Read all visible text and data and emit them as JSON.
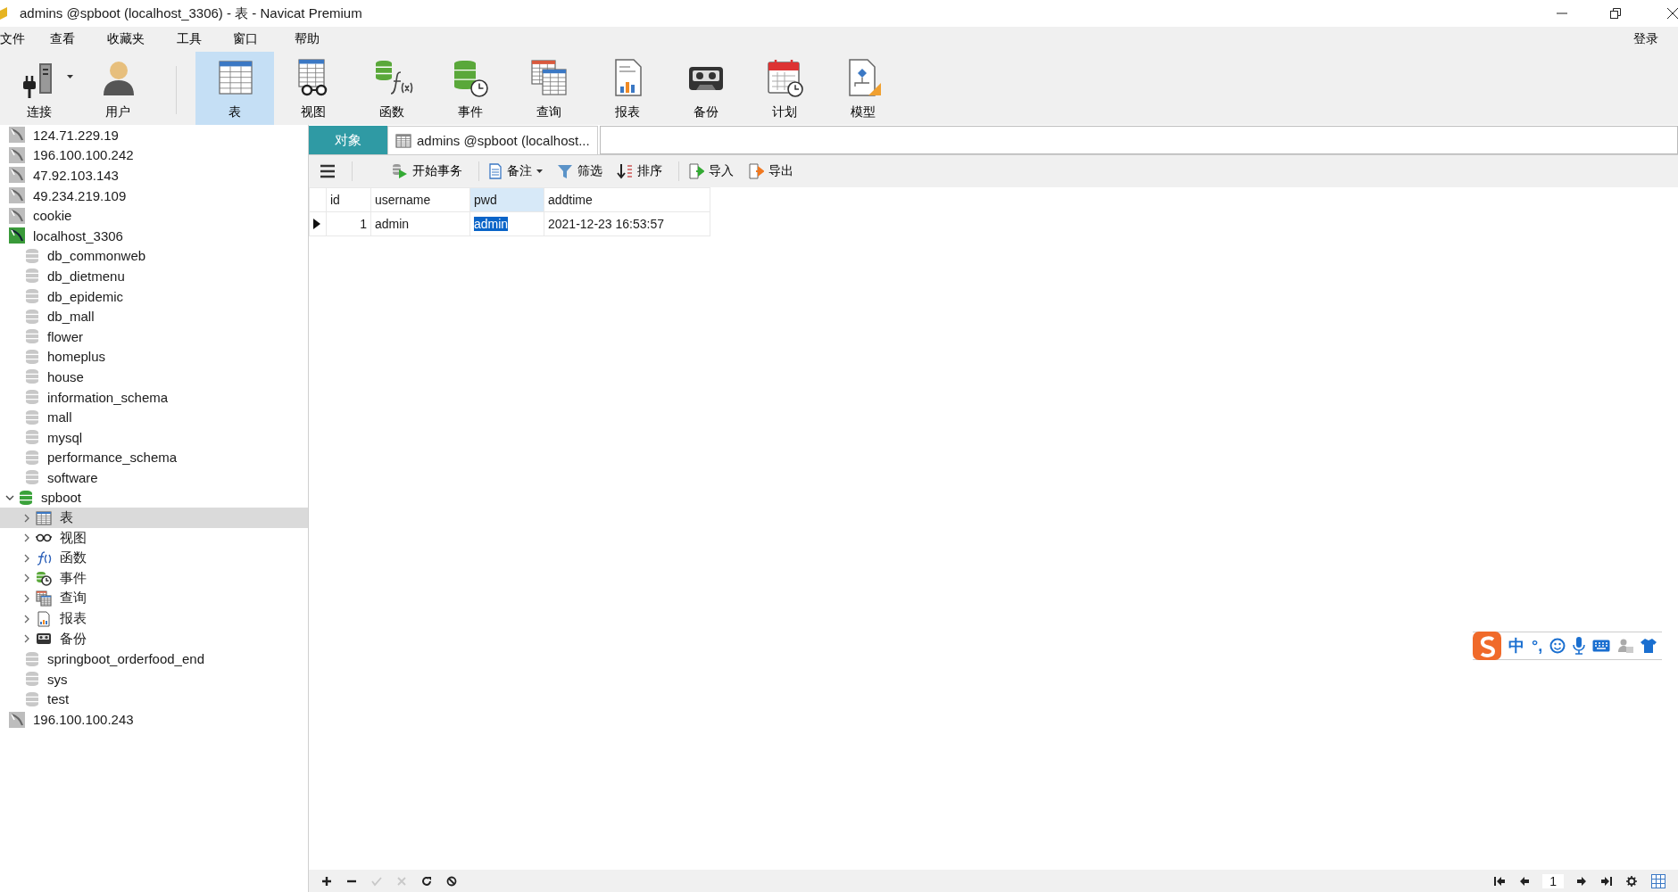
{
  "window": {
    "title": "admins @spboot (localhost_3306) - 表 - Navicat Premium"
  },
  "menu": [
    {
      "label": "文件"
    },
    {
      "label": "查看"
    },
    {
      "label": "收藏夹"
    },
    {
      "label": "工具"
    },
    {
      "label": "窗口"
    },
    {
      "label": "帮助"
    }
  ],
  "login": "登录",
  "toolbar": [
    {
      "label": "连接",
      "kind": "connect",
      "selected": false,
      "dropdown": true
    },
    {
      "label": "用户",
      "kind": "user",
      "selected": false,
      "dropdown": false
    },
    {
      "label": "表",
      "kind": "table",
      "selected": true,
      "dropdown": false
    },
    {
      "label": "视图",
      "kind": "view",
      "selected": false,
      "dropdown": false
    },
    {
      "label": "函数",
      "kind": "function",
      "selected": false,
      "dropdown": false
    },
    {
      "label": "事件",
      "kind": "event",
      "selected": false,
      "dropdown": false
    },
    {
      "label": "查询",
      "kind": "query",
      "selected": false,
      "dropdown": false
    },
    {
      "label": "报表",
      "kind": "report",
      "selected": false,
      "dropdown": false
    },
    {
      "label": "备份",
      "kind": "backup",
      "selected": false,
      "dropdown": false
    },
    {
      "label": "计划",
      "kind": "schedule",
      "selected": false,
      "dropdown": false
    },
    {
      "label": "模型",
      "kind": "model",
      "selected": false,
      "dropdown": false
    }
  ],
  "tree": [
    {
      "label": "124.71.229.19",
      "kind": "connection",
      "connected": false,
      "selected": false
    },
    {
      "label": "196.100.100.242",
      "kind": "connection",
      "connected": false,
      "selected": false
    },
    {
      "label": "47.92.103.143",
      "kind": "connection",
      "connected": false,
      "selected": false
    },
    {
      "label": "49.234.219.109",
      "kind": "connection",
      "connected": false,
      "selected": false
    },
    {
      "label": "cookie",
      "kind": "connection",
      "connected": false,
      "selected": false
    },
    {
      "label": "localhost_3306",
      "kind": "connection",
      "connected": true,
      "selected": false,
      "children": [
        {
          "label": "db_commonweb",
          "kind": "database",
          "open": false,
          "selected": false
        },
        {
          "label": "db_dietmenu",
          "kind": "database",
          "open": false,
          "selected": false
        },
        {
          "label": "db_epidemic",
          "kind": "database",
          "open": false,
          "selected": false
        },
        {
          "label": "db_mall",
          "kind": "database",
          "open": false,
          "selected": false
        },
        {
          "label": "flower",
          "kind": "database",
          "open": false,
          "selected": false
        },
        {
          "label": "homeplus",
          "kind": "database",
          "open": false,
          "selected": false
        },
        {
          "label": "house",
          "kind": "database",
          "open": false,
          "selected": false
        },
        {
          "label": "information_schema",
          "kind": "database",
          "open": false,
          "selected": false
        },
        {
          "label": "mall",
          "kind": "database",
          "open": false,
          "selected": false
        },
        {
          "label": "mysql",
          "kind": "database",
          "open": false,
          "selected": false
        },
        {
          "label": "performance_schema",
          "kind": "database",
          "open": false,
          "selected": false
        },
        {
          "label": "software",
          "kind": "database",
          "open": false,
          "selected": false
        },
        {
          "label": "spboot",
          "kind": "database",
          "open": true,
          "selected": false,
          "expanded": true,
          "children": [
            {
              "label": "表",
              "kind": "tables",
              "selected": true,
              "expanded": false
            },
            {
              "label": "视图",
              "kind": "views",
              "selected": false,
              "expanded": false
            },
            {
              "label": "函数",
              "kind": "functions",
              "selected": false,
              "expanded": false
            },
            {
              "label": "事件",
              "kind": "events",
              "selected": false,
              "expanded": false
            },
            {
              "label": "查询",
              "kind": "queries",
              "selected": false,
              "expanded": false
            },
            {
              "label": "报表",
              "kind": "reports",
              "selected": false,
              "expanded": false
            },
            {
              "label": "备份",
              "kind": "backups",
              "selected": false,
              "expanded": false
            }
          ]
        },
        {
          "label": "springboot_orderfood_end",
          "kind": "database",
          "open": false,
          "selected": false
        },
        {
          "label": "sys",
          "kind": "database",
          "open": false,
          "selected": false
        },
        {
          "label": "test",
          "kind": "database",
          "open": false,
          "selected": false
        }
      ]
    },
    {
      "label": "196.100.100.243",
      "kind": "connection",
      "connected": false,
      "selected": false
    }
  ],
  "tabs": [
    {
      "label": "对象",
      "kind": "objects",
      "selected": false
    },
    {
      "label": "admins @spboot (localhost...",
      "kind": "table",
      "selected": true
    }
  ],
  "grid_toolbar": [
    {
      "kind": "menu"
    },
    {
      "label": "开始事务",
      "kind": "transaction"
    },
    {
      "label": "备注",
      "kind": "note",
      "dropdown": true
    },
    {
      "label": "筛选",
      "kind": "filter"
    },
    {
      "label": "排序",
      "kind": "sort"
    },
    {
      "label": "导入",
      "kind": "import"
    },
    {
      "label": "导出",
      "kind": "export"
    }
  ],
  "table": {
    "columns": [
      {
        "label": "id",
        "selected": false
      },
      {
        "label": "username",
        "selected": false
      },
      {
        "label": "pwd",
        "selected": true
      },
      {
        "label": "addtime",
        "selected": false
      }
    ],
    "rows": [
      {
        "current": true,
        "cells": [
          {
            "text": "1",
            "selected": false
          },
          {
            "text": "admin",
            "selected": false
          },
          {
            "text": "admin",
            "selected": true
          },
          {
            "text": "2021-12-23 16:53:57",
            "selected": false
          }
        ]
      }
    ]
  },
  "status_bar": {
    "left": [
      {
        "kind": "add",
        "disabled": false
      },
      {
        "kind": "remove",
        "disabled": false
      },
      {
        "kind": "apply",
        "disabled": true
      },
      {
        "kind": "discard",
        "disabled": true
      },
      {
        "kind": "refresh",
        "disabled": false
      },
      {
        "kind": "stop",
        "disabled": false
      }
    ],
    "page": "1",
    "right_before": [
      {
        "kind": "first"
      },
      {
        "kind": "prev"
      }
    ],
    "right_after": [
      {
        "kind": "next"
      },
      {
        "kind": "last"
      },
      {
        "kind": "settings"
      },
      {
        "kind": "grid-view"
      }
    ]
  },
  "ime": {
    "mode": "中",
    "punctuation": "°,"
  }
}
